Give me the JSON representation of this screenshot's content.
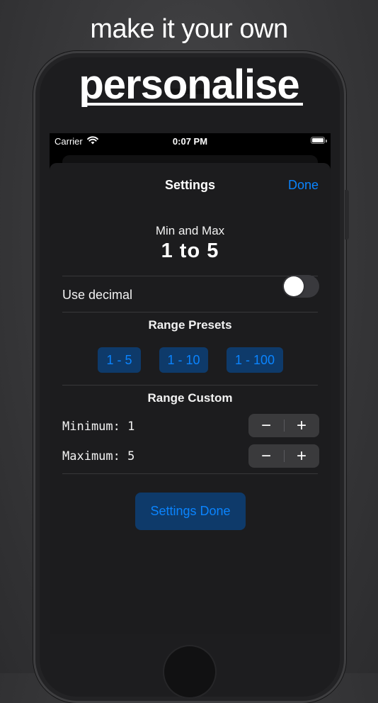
{
  "headline": "make it your own",
  "title": "personalise",
  "status_bar": {
    "carrier": "Carrier",
    "time": "0:07 PM",
    "wifi_icon": "wifi-icon",
    "battery_icon": "battery-icon"
  },
  "nav": {
    "title": "Settings",
    "done_label": "Done"
  },
  "summary": {
    "label": "Min and Max",
    "value": "1 to 5"
  },
  "decimal": {
    "label": "Use decimal",
    "enabled": false
  },
  "presets": {
    "title": "Range Presets",
    "items": [
      {
        "label": "1 - 5"
      },
      {
        "label": "1 - 10"
      },
      {
        "label": "1 - 100"
      }
    ]
  },
  "custom": {
    "title": "Range Custom",
    "minimum_label": "Minimum: 1",
    "maximum_label": "Maximum: 5",
    "minus_symbol": "−",
    "plus_symbol": "+"
  },
  "settings_done_label": "Settings Done",
  "colors": {
    "accent": "#0a84ff",
    "button_fill": "#0e3a6a",
    "sheet_background": "#1c1c1e"
  }
}
